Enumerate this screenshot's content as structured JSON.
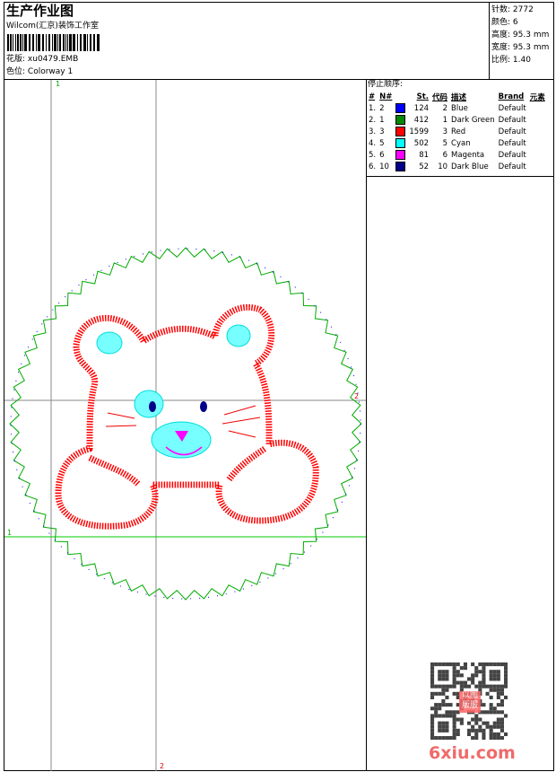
{
  "header": {
    "title": "生产作业图",
    "studio": "Wilcom(汇京)装饰工作室",
    "design_label": "花版:",
    "design_file": "xu0479.EMB",
    "colorway_label": "色位:",
    "colorway": "Colorway 1"
  },
  "info": [
    {
      "label": "针数:",
      "value": "2772"
    },
    {
      "label": "颜色:",
      "value": "6"
    },
    {
      "label": "高度:",
      "value": "95.3 mm"
    },
    {
      "label": "宽度:",
      "value": "95.3 mm"
    },
    {
      "label": "比例:",
      "value": "1.40"
    }
  ],
  "stop_sequence": {
    "title": "停止顺序:",
    "columns": [
      "#",
      "N#",
      "St.",
      "代码",
      "描述",
      "Brand",
      "元素"
    ],
    "rows": [
      {
        "seq": "1.",
        "n": "2",
        "color": "#0000ff",
        "st": "124",
        "code": "2",
        "desc": "Blue",
        "brand": "Default"
      },
      {
        "seq": "2.",
        "n": "1",
        "color": "#008800",
        "st": "412",
        "code": "1",
        "desc": "Dark Green",
        "brand": "Default"
      },
      {
        "seq": "3.",
        "n": "3",
        "color": "#ff0000",
        "st": "1599",
        "code": "3",
        "desc": "Red",
        "brand": "Default"
      },
      {
        "seq": "4.",
        "n": "5",
        "color": "#00ffff",
        "st": "502",
        "code": "5",
        "desc": "Cyan",
        "brand": "Default"
      },
      {
        "seq": "5.",
        "n": "6",
        "color": "#ff00ff",
        "st": "81",
        "code": "6",
        "desc": "Magenta",
        "brand": "Default"
      },
      {
        "seq": "6.",
        "n": "10",
        "color": "#000088",
        "st": "52",
        "code": "10",
        "desc": "Dark Blue",
        "brand": "Default"
      }
    ]
  },
  "guides": {
    "v1": "1",
    "v2": "2",
    "h1": "1",
    "h2": "2"
  },
  "watermark": {
    "text": "6xiu.com",
    "seal": "以图版服"
  }
}
